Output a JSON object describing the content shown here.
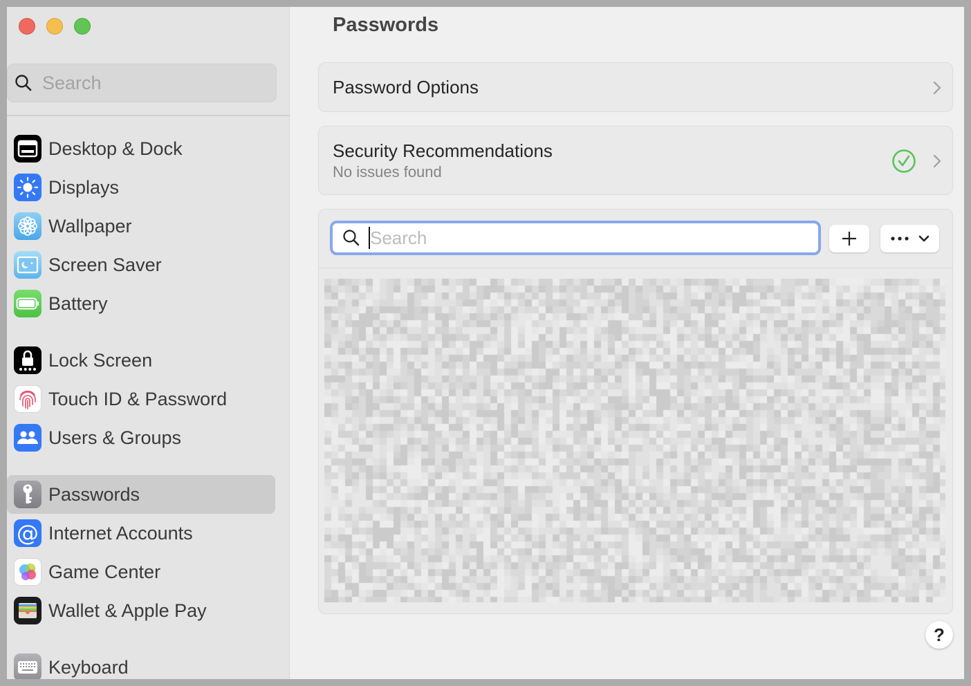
{
  "window": {
    "traffic_lights": [
      "close",
      "minimize",
      "zoom"
    ]
  },
  "sidebar": {
    "search_placeholder": "Search",
    "selected": "Passwords",
    "items": [
      {
        "label": "Desktop & Dock",
        "icon": "desktop-dock-icon",
        "color": "#000000"
      },
      {
        "label": "Displays",
        "icon": "sun-icon",
        "color": "#3478f6"
      },
      {
        "label": "Wallpaper",
        "icon": "flower-icon",
        "color": "#62b8f0"
      },
      {
        "label": "Screen Saver",
        "icon": "screen-saver-icon",
        "color": "#6cc3f0"
      },
      {
        "label": "Battery",
        "icon": "battery-icon",
        "color": "#5fcc5a"
      },
      {
        "label": "Lock Screen",
        "icon": "lock-icon",
        "color": "#000000"
      },
      {
        "label": "Touch ID & Password",
        "icon": "fingerprint-icon",
        "color": "#ffffff"
      },
      {
        "label": "Users & Groups",
        "icon": "users-icon",
        "color": "#3478f6"
      },
      {
        "label": "Passwords",
        "icon": "key-icon",
        "color": "#8e8e93"
      },
      {
        "label": "Internet Accounts",
        "icon": "at-icon",
        "color": "#3478f6"
      },
      {
        "label": "Game Center",
        "icon": "game-center-icon",
        "color": "#ffffff"
      },
      {
        "label": "Wallet & Apple Pay",
        "icon": "wallet-icon",
        "color": "#1c1c1e"
      },
      {
        "label": "Keyboard",
        "icon": "keyboard-icon",
        "color": "#9a9a9e"
      }
    ]
  },
  "main": {
    "title": "Passwords",
    "password_options": {
      "label": "Password Options"
    },
    "security": {
      "label": "Security Recommendations",
      "status": "No issues found",
      "status_color": "#5ac35a"
    },
    "list": {
      "search_placeholder": "Search",
      "add_label": "+",
      "more_label": "•••",
      "content": "redacted"
    },
    "help_label": "?"
  },
  "colors": {
    "accent_focus": "#88a8ec",
    "sidebar_bg": "#e3e4e3",
    "content_bg": "#eff0ef"
  }
}
